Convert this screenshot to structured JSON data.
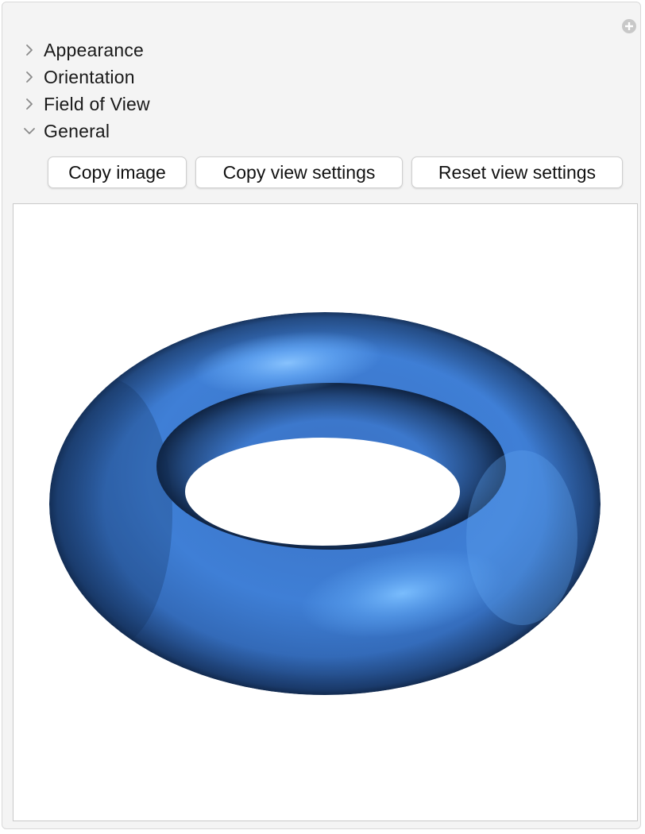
{
  "panel": {
    "add_icon": "plus-circle-icon",
    "sections": [
      {
        "label": "Appearance",
        "expanded": false,
        "icon": "chevron-right-icon"
      },
      {
        "label": "Orientation",
        "expanded": false,
        "icon": "chevron-right-icon"
      },
      {
        "label": "Field of View",
        "expanded": false,
        "icon": "chevron-right-icon"
      },
      {
        "label": "General",
        "expanded": true,
        "icon": "chevron-down-icon"
      }
    ],
    "buttons": {
      "copy_image": "Copy image",
      "copy_view_settings": "Copy view settings",
      "reset_view_settings": "Reset view settings"
    }
  },
  "scene": {
    "object": "torus",
    "color": "#3f7fd6",
    "highlight_color": "#6fb4ff",
    "shadow_color": "#0a1a33",
    "background": "#ffffff"
  }
}
